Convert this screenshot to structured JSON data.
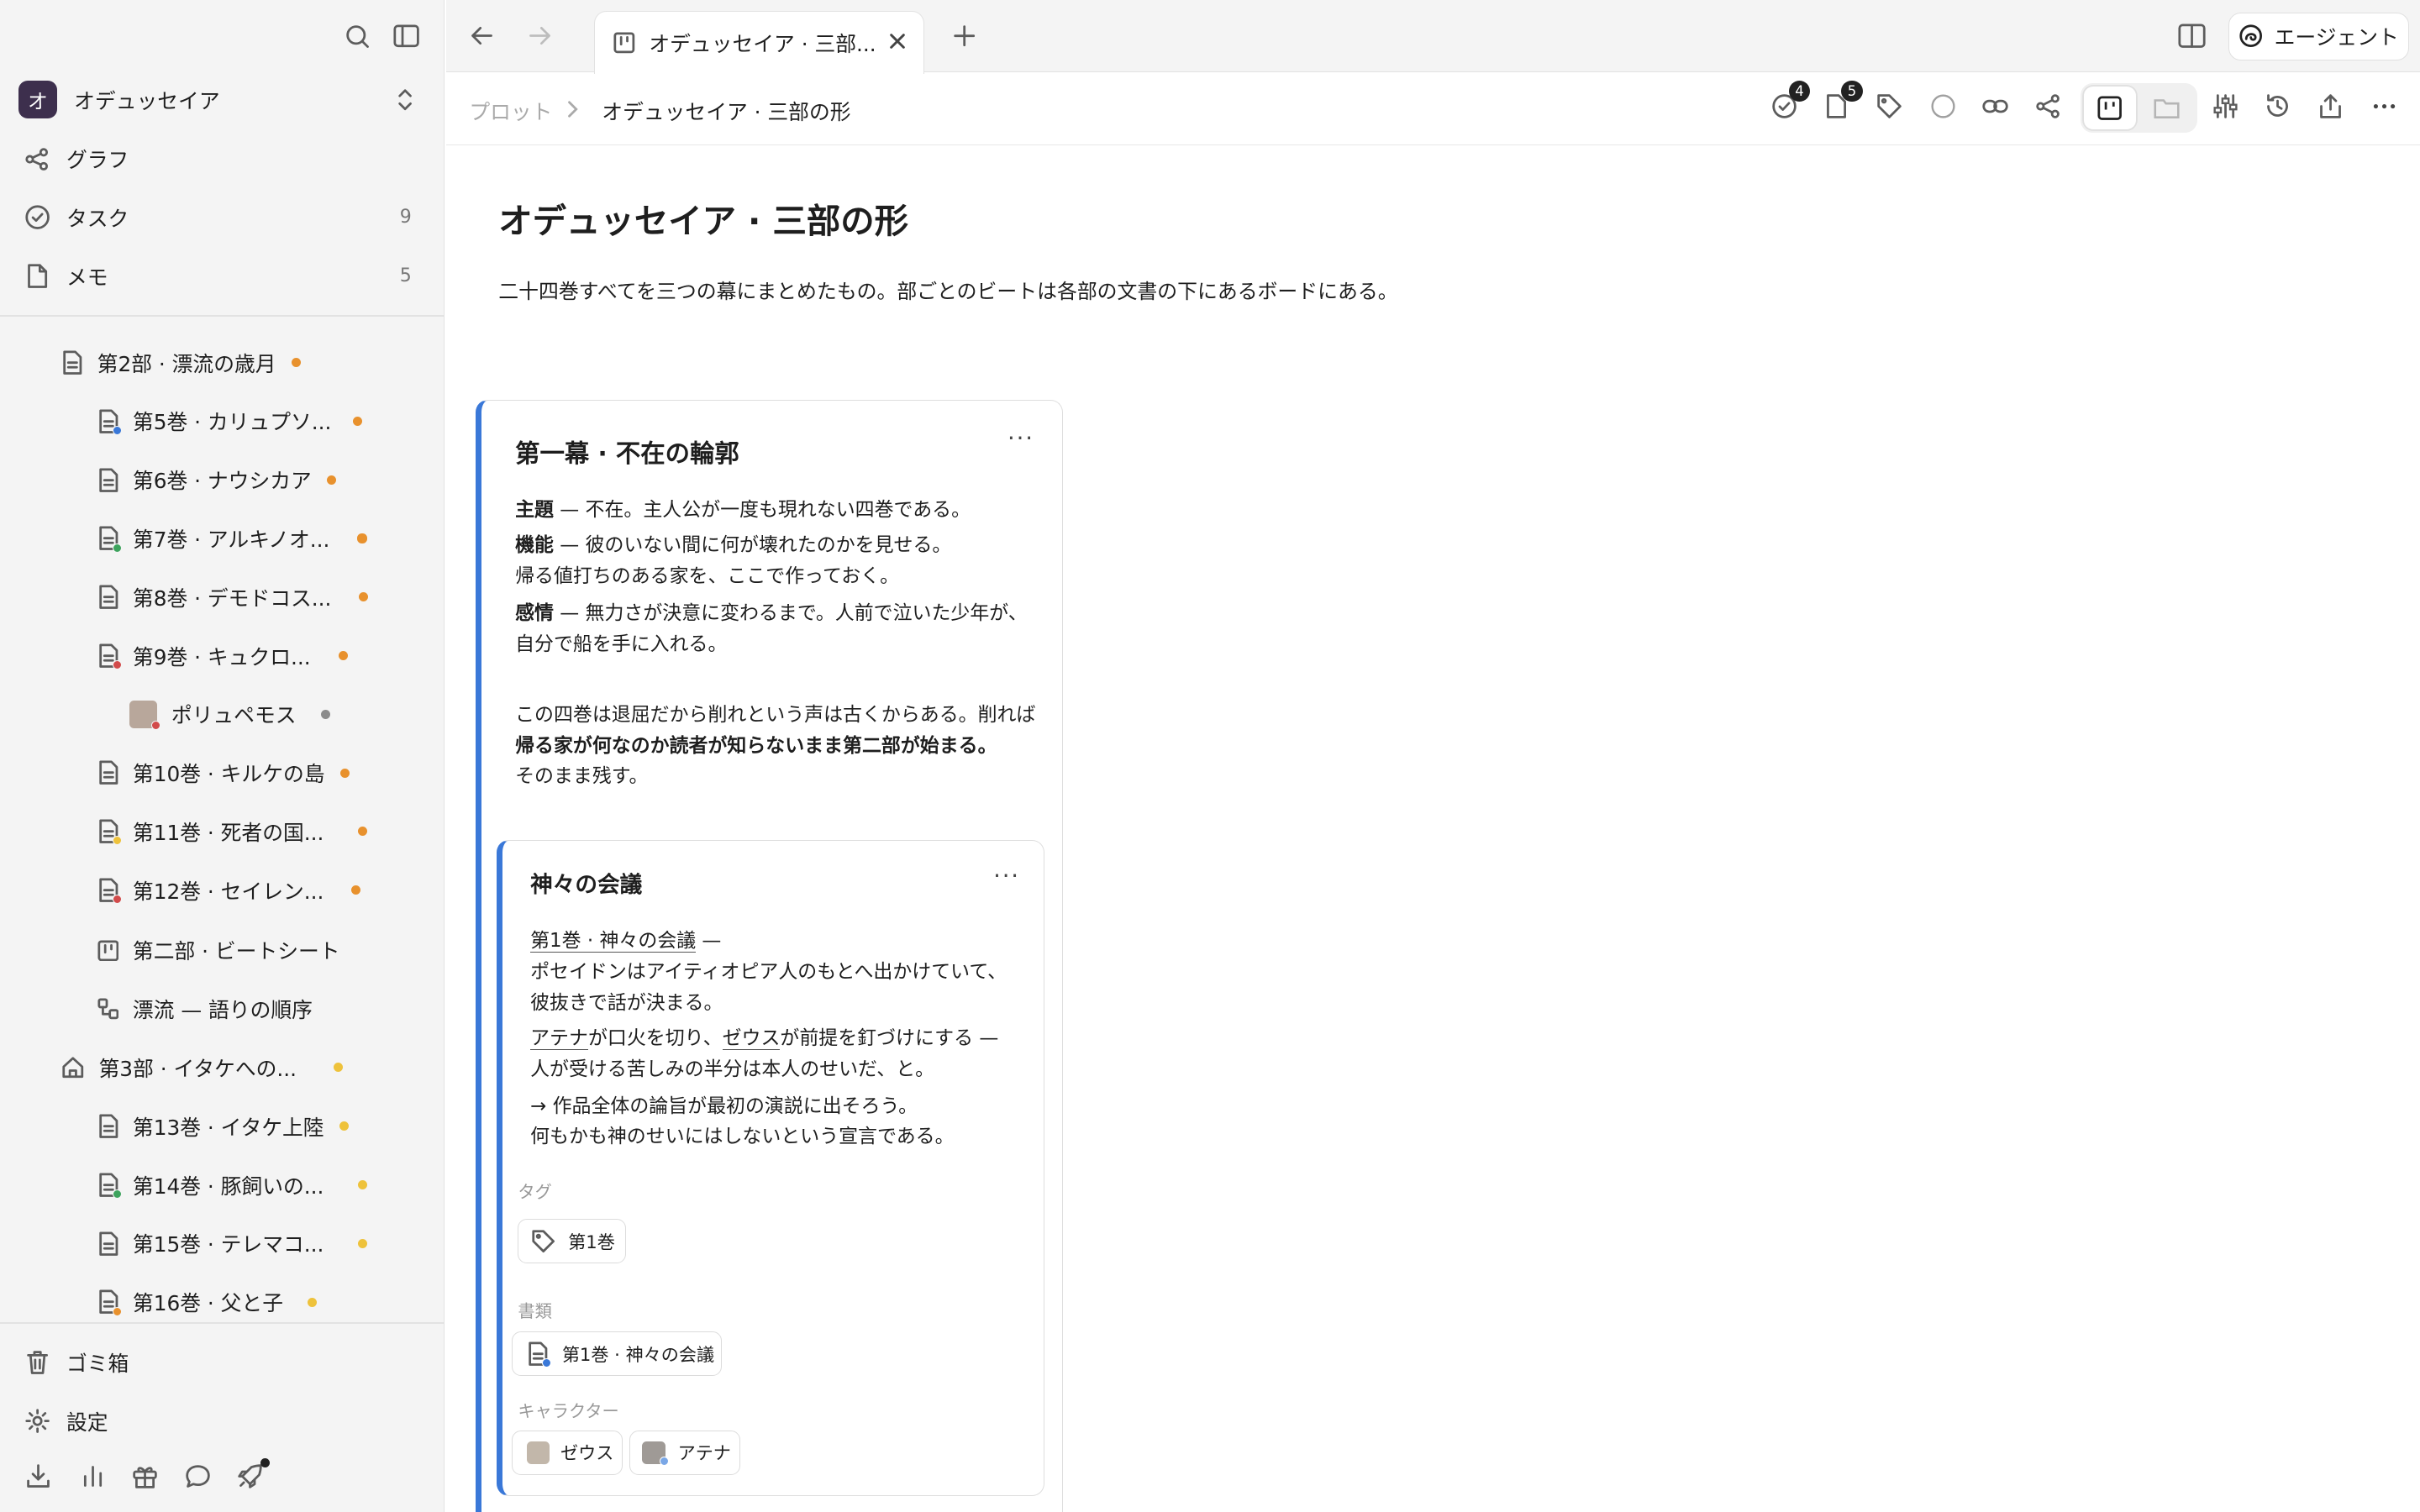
{
  "workspace": {
    "avatar": "オ",
    "name": "オデュッセイア"
  },
  "nav": [
    {
      "label": "グラフ",
      "count": ""
    },
    {
      "label": "タスク",
      "count": "9"
    },
    {
      "label": "メモ",
      "count": "5"
    }
  ],
  "tree": [
    "第2部 · 漂流の歳月",
    "第5巻 · カリュプソ...",
    "第6巻 · ナウシカア",
    "第7巻 · アルキノオ...",
    "第8巻 · デモドコス...",
    "第9巻 · キュクロ...",
    "ポリュペモス",
    "第10巻 · キルケの島",
    "第11巻 · 死者の国...",
    "第12巻 · セイレン...",
    "第二部 · ビートシート",
    "漂流 — 語りの順序",
    "第3部 · イタケへの...",
    "第13巻 · イタケ上陸",
    "第14巻 · 豚飼いの...",
    "第15巻 · テレマコ...",
    "第16巻 · 父と子"
  ],
  "bottom_nav": {
    "trash": "ゴミ箱",
    "settings": "設定"
  },
  "tab": {
    "title": "オデュッセイア · 三部..."
  },
  "agent_label": "エージェント",
  "breadcrumb": {
    "parent": "プロット",
    "current": "オデュッセイア · 三部の形"
  },
  "toolbar": {
    "tasks_count": "4",
    "notes_count": "5"
  },
  "page": {
    "title": "オデュッセイア · 三部の形",
    "description": "二十四巻すべてを三つの幕にまとめたもの。部ごとのビートは各部の文書の下にあるボードにある。"
  },
  "card": {
    "title": "第一幕 · 不在の輪郭",
    "theme_key": "主題",
    "theme": " — 不在。主人公が一度も現れない四巻である。",
    "function_key": "機能",
    "function_1": " — 彼のいない間に何が壊れたのかを見せる。",
    "function_2": "帰る値打ちのある家を、ここで作っておく。",
    "emotion_key": "感情",
    "emotion_1": " — 無力さが決意に変わるまで。人前で泣いた少年が、",
    "emotion_2": "自分で船を手に入れる。",
    "note_1": "この四巻は退屈だから削れという声は古くからある。削れば",
    "note_2": "帰る家が何なのか読者が知らないまま第二部が始まる。",
    "note_3": "そのまま残す。"
  },
  "subcard": {
    "title": "神々の会議",
    "link_1": "第1巻 · 神々の会議",
    "dash": " —",
    "line_1": "ポセイドンはアイティオピア人のもとへ出かけていて、",
    "line_2": "彼抜きで話が決まる。",
    "athena": "アテナ",
    "mid_1": "が口火を切り、",
    "zeus": "ゼウス",
    "mid_2": "が前提を釘づけにする —",
    "line_3": "人が受ける苦しみの半分は本人のせいだ、と。",
    "line_4": "→ 作品全体の論旨が最初の演説に出そろう。",
    "line_5": "何もかも神のせいにはしないという宣言である。",
    "tag_label": "タグ",
    "tag": "第1巻",
    "doc_label": "書類",
    "doc": "第1巻 · 神々の会議",
    "char_label": "キャラクター",
    "char_1": "ゼウス",
    "char_2": "アテナ"
  },
  "colors": {
    "orange": "#e8912d",
    "yellow": "#eec23b",
    "gray": "#8c8c8c",
    "accent": "#3a78d8"
  }
}
